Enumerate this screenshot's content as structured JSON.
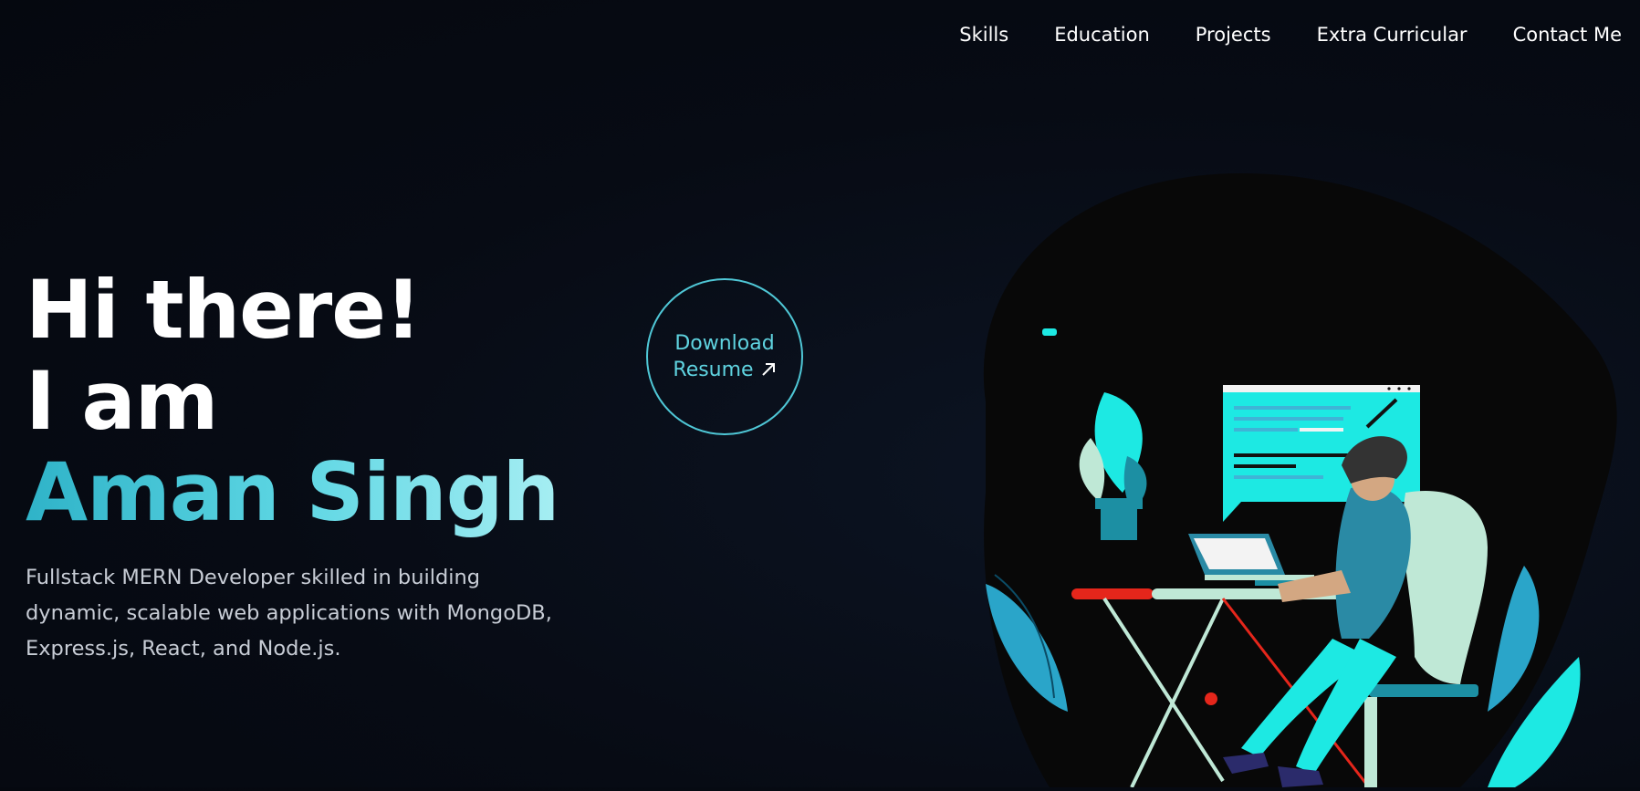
{
  "nav": {
    "items": [
      "Skills",
      "Education",
      "Projects",
      "Extra Curricular",
      "Contact Me"
    ]
  },
  "hero": {
    "line1": "Hi there!",
    "line2": "I am",
    "name": "Aman Singh",
    "description": "Fullstack MERN Developer skilled in building dynamic, scalable web applications with MongoDB, Express.js, React, and Node.js."
  },
  "resume_button": {
    "line1": "Download",
    "line2": "Resume",
    "icon": "arrow-up-right-icon"
  },
  "illustration": {
    "icon": "developer-at-desk-illustration"
  },
  "colors": {
    "accent": "#4fc7d6",
    "background": "#070b14",
    "illustration_teal": "#1de9e3",
    "illustration_red": "#e5261b"
  }
}
